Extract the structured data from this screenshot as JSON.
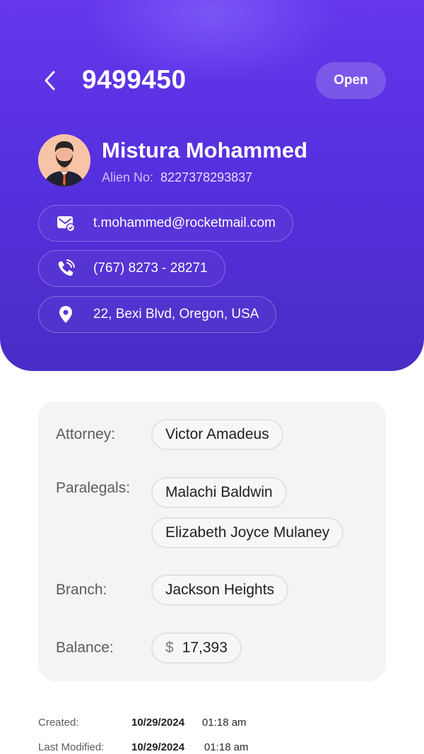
{
  "header": {
    "case_id": "9499450",
    "status": "Open"
  },
  "client": {
    "name": "Mistura Mohammed",
    "alien_label": "Alien No:",
    "alien_number": "8227378293837"
  },
  "contacts": {
    "email": "t.mohammed@rocketmail.com",
    "phone": "(767) 8273 - 28271",
    "address": "22, Bexi Blvd, Oregon, USA"
  },
  "details": {
    "attorney_label": "Attorney:",
    "attorney": "Victor Amadeus",
    "paralegals_label": "Paralegals:",
    "paralegals": [
      "Malachi Baldwin",
      "Elizabeth Joyce Mulaney"
    ],
    "branch_label": "Branch:",
    "branch": "Jackson Heights",
    "balance_label": "Balance:",
    "currency": "$",
    "balance": "17,393"
  },
  "meta": {
    "created_label": "Created:",
    "created_date": "10/29/2024",
    "created_time": "01:18 am",
    "modified_label": "Last Modified:",
    "modified_date": "10/29/2024",
    "modified_time": "01:18 am"
  },
  "colors": {
    "header_gradient_top": "#6437ec",
    "header_gradient_bottom": "#4a2cc6",
    "card_background": "#f4f4f4"
  },
  "icons": [
    "chevron-left-icon",
    "email-icon",
    "phone-icon",
    "location-pin-icon",
    "avatar-illustration"
  ]
}
